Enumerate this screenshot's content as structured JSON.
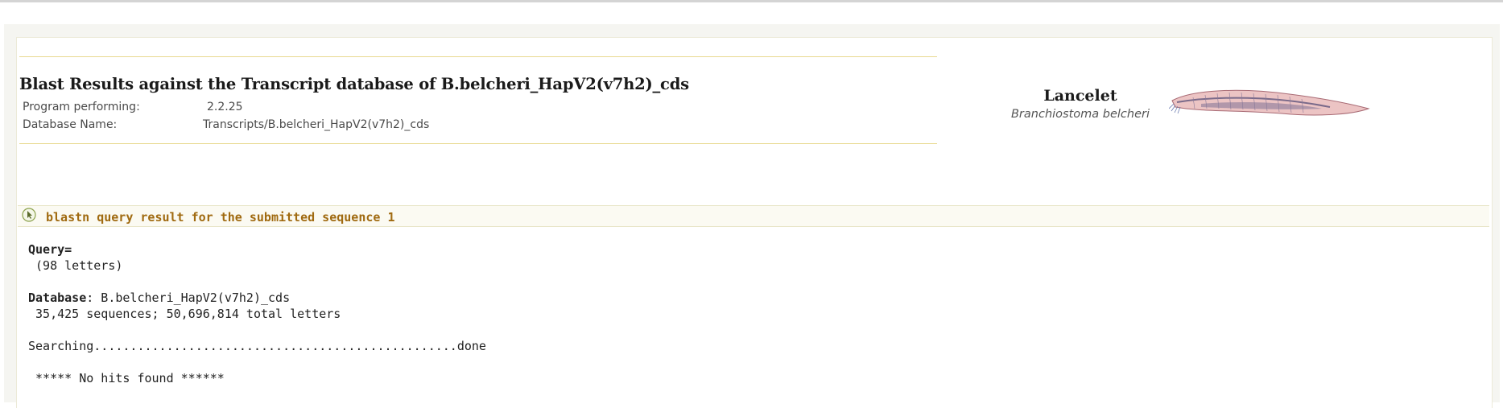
{
  "header": {
    "title": "Blast Results against the Transcript database of B.belcheri_HapV2(v7h2)_cds",
    "program_label": "Program performing:",
    "program_value": "2.2.25",
    "database_label": "Database Name:",
    "database_value": "Transcripts/B.belcheri_HapV2(v7h2)_cds"
  },
  "species": {
    "common_name": "Lancelet",
    "latin_name": "Branchiostoma belcheri"
  },
  "section": {
    "title": "blastn query result for the submitted sequence 1",
    "icon": "arrow-circle-icon"
  },
  "result": {
    "query_label": "Query=",
    "query_length": " (98 letters)",
    "database_label": "Database",
    "database_value": ": B.belcheri_HapV2(v7h2)_cds",
    "database_stats": " 35,425 sequences; 50,696,814 total letters",
    "searching": "Searching..................................................done",
    "no_hits": " ***** No hits found ******"
  },
  "colors": {
    "section_title": "#a06a10",
    "rule": "#e8d98f",
    "fish_body": "#e8b8b8"
  }
}
